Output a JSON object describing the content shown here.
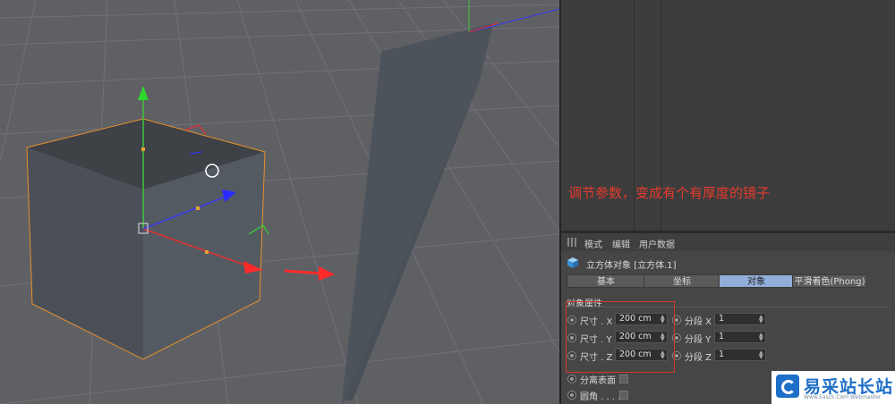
{
  "annotation_note": "调节参数，变成有个有厚度的镜子",
  "attribute_manager": {
    "menu": [
      "模式",
      "编辑",
      "用户数据"
    ],
    "object_title": "立方体对象 [立方体.1]",
    "tabs": [
      {
        "label": "基本",
        "active": false
      },
      {
        "label": "坐标",
        "active": false
      },
      {
        "label": "对象",
        "active": true
      },
      {
        "label": "平滑着色(Phong)",
        "active": false
      }
    ],
    "section_title": "对象属性",
    "size_rows": [
      {
        "label": "尺寸 . X",
        "value": "200 cm"
      },
      {
        "label": "尺寸 . Y",
        "value": "200 cm"
      },
      {
        "label": "尺寸 . Z",
        "value": "200 cm"
      }
    ],
    "segment_rows": [
      {
        "label": "分段 X",
        "value": "1"
      },
      {
        "label": "分段 Y",
        "value": "1"
      },
      {
        "label": "分段 Z",
        "value": "1"
      }
    ],
    "options": [
      {
        "label": "分离表面",
        "checked": false
      },
      {
        "label": "圆角 . . . .",
        "checked": false
      }
    ]
  },
  "watermark": {
    "name": "易采站长站",
    "url": "Www.Easck.Com Webmaster"
  },
  "colors": {
    "accent_tab": "#92aeda",
    "annotation_red": "#e63a2e",
    "viewport_bg": "#5f6064",
    "selection_orange": "#e8902a"
  }
}
